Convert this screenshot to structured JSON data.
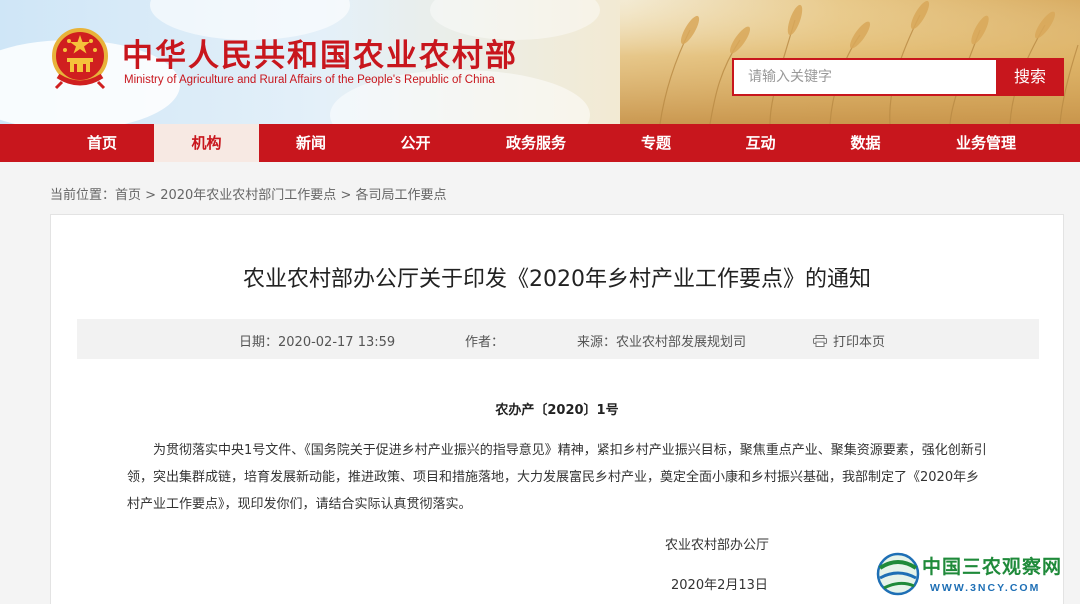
{
  "header": {
    "title": "中华人民共和国农业农村部",
    "subtitle": "Ministry of Agriculture and Rural Affairs of the People's Republic of China",
    "search_placeholder": "请输入关键字",
    "search_button": "搜索"
  },
  "nav": {
    "items": [
      {
        "label": "首页",
        "active": false
      },
      {
        "label": "机构",
        "active": true
      },
      {
        "label": "新闻",
        "active": false
      },
      {
        "label": "公开",
        "active": false
      },
      {
        "label": "政务服务",
        "active": false
      },
      {
        "label": "专题",
        "active": false
      },
      {
        "label": "互动",
        "active": false
      },
      {
        "label": "数据",
        "active": false
      },
      {
        "label": "业务管理",
        "active": false
      }
    ]
  },
  "breadcrumb": {
    "prefix": "当前位置：",
    "items": [
      "首页",
      "2020年农业农村部门工作要点",
      "各司局工作要点"
    ],
    "separator": ">"
  },
  "article": {
    "title": "农业农村部办公厅关于印发《2020年乡村产业工作要点》的通知",
    "meta": {
      "date_label": "日期：",
      "date": "2020-02-17 13:59",
      "author_label": "作者：",
      "author": "",
      "source_label": "来源：",
      "source": "农业农村部发展规划司",
      "print_label": "打印本页"
    },
    "doc_number": "农办产〔2020〕1号",
    "body": "为贯彻落实中央1号文件、《国务院关于促进乡村产业振兴的指导意见》精神，紧扣乡村产业振兴目标，聚焦重点产业、聚集资源要素，强化创新引领，突出集群成链，培育发展新动能，推进政策、项目和措施落地，大力发展富民乡村产业，奠定全面小康和乡村振兴基础，我部制定了《2020年乡村产业工作要点》，现印发你们，请结合实际认真贯彻落实。",
    "signature": "农业农村部办公厅",
    "sign_date": "2020年2月13日"
  },
  "watermark": {
    "name": "中国三农观察网",
    "url": "WWW.3NCY.COM"
  },
  "colors": {
    "brand_red": "#c8161d",
    "nav_active_bg": "#f7e9e3",
    "watermark_green": "#1f8a3a",
    "watermark_blue": "#1e6fb5"
  },
  "icons": {
    "emblem": "national-emblem-icon",
    "print": "printer-icon",
    "watermark_logo": "globe-logo-icon"
  }
}
